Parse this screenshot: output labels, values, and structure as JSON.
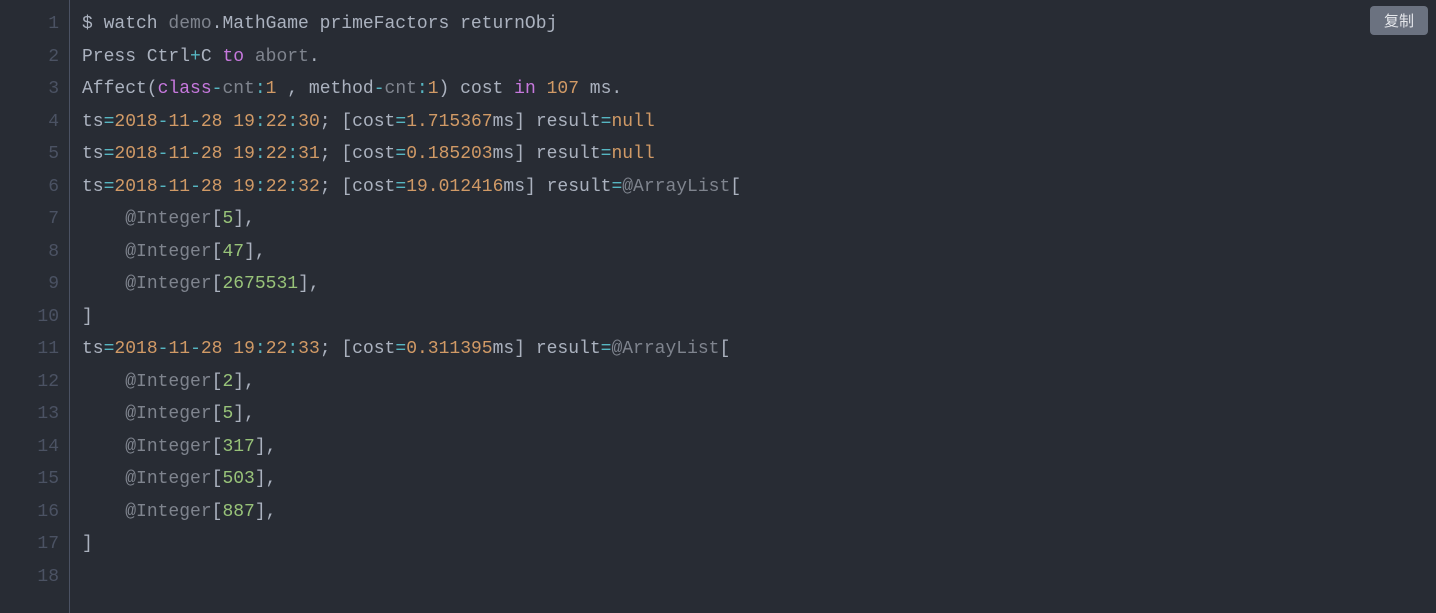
{
  "copy_button_label": "复制",
  "line_count": 18,
  "lines": {
    "1": [
      {
        "t": "$ watch ",
        "c": "tok-default"
      },
      {
        "t": "demo",
        "c": "tok-gray"
      },
      {
        "t": ".MathGame primeFactors returnObj",
        "c": "tok-default"
      }
    ],
    "2": [
      {
        "t": "Press Ctrl",
        "c": "tok-default"
      },
      {
        "t": "+",
        "c": "tok-teal"
      },
      {
        "t": "C ",
        "c": "tok-default"
      },
      {
        "t": "to",
        "c": "tok-purple"
      },
      {
        "t": " ",
        "c": "tok-default"
      },
      {
        "t": "abort",
        "c": "tok-gray"
      },
      {
        "t": ".",
        "c": "tok-default"
      }
    ],
    "3": [
      {
        "t": "Affect(",
        "c": "tok-default"
      },
      {
        "t": "class",
        "c": "tok-purple"
      },
      {
        "t": "-",
        "c": "tok-teal"
      },
      {
        "t": "cnt",
        "c": "tok-gray"
      },
      {
        "t": ":",
        "c": "tok-teal"
      },
      {
        "t": "1",
        "c": "tok-orange"
      },
      {
        "t": " , method",
        "c": "tok-default"
      },
      {
        "t": "-",
        "c": "tok-teal"
      },
      {
        "t": "cnt",
        "c": "tok-gray"
      },
      {
        "t": ":",
        "c": "tok-teal"
      },
      {
        "t": "1",
        "c": "tok-orange"
      },
      {
        "t": ") cost ",
        "c": "tok-default"
      },
      {
        "t": "in",
        "c": "tok-purple"
      },
      {
        "t": " ",
        "c": "tok-default"
      },
      {
        "t": "107",
        "c": "tok-orange"
      },
      {
        "t": " ms.",
        "c": "tok-default"
      }
    ],
    "4": [
      {
        "t": "ts",
        "c": "tok-default"
      },
      {
        "t": "=",
        "c": "tok-teal"
      },
      {
        "t": "2018",
        "c": "tok-orange"
      },
      {
        "t": "-",
        "c": "tok-teal"
      },
      {
        "t": "11",
        "c": "tok-orange"
      },
      {
        "t": "-",
        "c": "tok-teal"
      },
      {
        "t": "28",
        "c": "tok-orange"
      },
      {
        "t": " ",
        "c": "tok-default"
      },
      {
        "t": "19",
        "c": "tok-orange"
      },
      {
        "t": ":",
        "c": "tok-teal"
      },
      {
        "t": "22",
        "c": "tok-orange"
      },
      {
        "t": ":",
        "c": "tok-teal"
      },
      {
        "t": "30",
        "c": "tok-orange"
      },
      {
        "t": "; [cost",
        "c": "tok-default"
      },
      {
        "t": "=",
        "c": "tok-teal"
      },
      {
        "t": "1.715367",
        "c": "tok-orange"
      },
      {
        "t": "ms] result",
        "c": "tok-default"
      },
      {
        "t": "=",
        "c": "tok-teal"
      },
      {
        "t": "null",
        "c": "tok-orange"
      }
    ],
    "5": [
      {
        "t": "ts",
        "c": "tok-default"
      },
      {
        "t": "=",
        "c": "tok-teal"
      },
      {
        "t": "2018",
        "c": "tok-orange"
      },
      {
        "t": "-",
        "c": "tok-teal"
      },
      {
        "t": "11",
        "c": "tok-orange"
      },
      {
        "t": "-",
        "c": "tok-teal"
      },
      {
        "t": "28",
        "c": "tok-orange"
      },
      {
        "t": " ",
        "c": "tok-default"
      },
      {
        "t": "19",
        "c": "tok-orange"
      },
      {
        "t": ":",
        "c": "tok-teal"
      },
      {
        "t": "22",
        "c": "tok-orange"
      },
      {
        "t": ":",
        "c": "tok-teal"
      },
      {
        "t": "31",
        "c": "tok-orange"
      },
      {
        "t": "; [cost",
        "c": "tok-default"
      },
      {
        "t": "=",
        "c": "tok-teal"
      },
      {
        "t": "0.185203",
        "c": "tok-orange"
      },
      {
        "t": "ms] result",
        "c": "tok-default"
      },
      {
        "t": "=",
        "c": "tok-teal"
      },
      {
        "t": "null",
        "c": "tok-orange"
      }
    ],
    "6": [
      {
        "t": "ts",
        "c": "tok-default"
      },
      {
        "t": "=",
        "c": "tok-teal"
      },
      {
        "t": "2018",
        "c": "tok-orange"
      },
      {
        "t": "-",
        "c": "tok-teal"
      },
      {
        "t": "11",
        "c": "tok-orange"
      },
      {
        "t": "-",
        "c": "tok-teal"
      },
      {
        "t": "28",
        "c": "tok-orange"
      },
      {
        "t": " ",
        "c": "tok-default"
      },
      {
        "t": "19",
        "c": "tok-orange"
      },
      {
        "t": ":",
        "c": "tok-teal"
      },
      {
        "t": "22",
        "c": "tok-orange"
      },
      {
        "t": ":",
        "c": "tok-teal"
      },
      {
        "t": "32",
        "c": "tok-orange"
      },
      {
        "t": "; [cost",
        "c": "tok-default"
      },
      {
        "t": "=",
        "c": "tok-teal"
      },
      {
        "t": "19.012416",
        "c": "tok-orange"
      },
      {
        "t": "ms] result",
        "c": "tok-default"
      },
      {
        "t": "=",
        "c": "tok-teal"
      },
      {
        "t": "@ArrayList",
        "c": "tok-gray"
      },
      {
        "t": "[",
        "c": "tok-default"
      }
    ],
    "7": [
      {
        "t": "    ",
        "c": "tok-default"
      },
      {
        "t": "@Integer",
        "c": "tok-gray"
      },
      {
        "t": "[",
        "c": "tok-default"
      },
      {
        "t": "5",
        "c": "tok-green"
      },
      {
        "t": "],",
        "c": "tok-default"
      }
    ],
    "8": [
      {
        "t": "    ",
        "c": "tok-default"
      },
      {
        "t": "@Integer",
        "c": "tok-gray"
      },
      {
        "t": "[",
        "c": "tok-default"
      },
      {
        "t": "47",
        "c": "tok-green"
      },
      {
        "t": "],",
        "c": "tok-default"
      }
    ],
    "9": [
      {
        "t": "    ",
        "c": "tok-default"
      },
      {
        "t": "@Integer",
        "c": "tok-gray"
      },
      {
        "t": "[",
        "c": "tok-default"
      },
      {
        "t": "2675531",
        "c": "tok-green"
      },
      {
        "t": "],",
        "c": "tok-default"
      }
    ],
    "10": [
      {
        "t": "]",
        "c": "tok-default"
      }
    ],
    "11": [
      {
        "t": "ts",
        "c": "tok-default"
      },
      {
        "t": "=",
        "c": "tok-teal"
      },
      {
        "t": "2018",
        "c": "tok-orange"
      },
      {
        "t": "-",
        "c": "tok-teal"
      },
      {
        "t": "11",
        "c": "tok-orange"
      },
      {
        "t": "-",
        "c": "tok-teal"
      },
      {
        "t": "28",
        "c": "tok-orange"
      },
      {
        "t": " ",
        "c": "tok-default"
      },
      {
        "t": "19",
        "c": "tok-orange"
      },
      {
        "t": ":",
        "c": "tok-teal"
      },
      {
        "t": "22",
        "c": "tok-orange"
      },
      {
        "t": ":",
        "c": "tok-teal"
      },
      {
        "t": "33",
        "c": "tok-orange"
      },
      {
        "t": "; [cost",
        "c": "tok-default"
      },
      {
        "t": "=",
        "c": "tok-teal"
      },
      {
        "t": "0.311395",
        "c": "tok-orange"
      },
      {
        "t": "ms] result",
        "c": "tok-default"
      },
      {
        "t": "=",
        "c": "tok-teal"
      },
      {
        "t": "@ArrayList",
        "c": "tok-gray"
      },
      {
        "t": "[",
        "c": "tok-default"
      }
    ],
    "12": [
      {
        "t": "    ",
        "c": "tok-default"
      },
      {
        "t": "@Integer",
        "c": "tok-gray"
      },
      {
        "t": "[",
        "c": "tok-default"
      },
      {
        "t": "2",
        "c": "tok-green"
      },
      {
        "t": "],",
        "c": "tok-default"
      }
    ],
    "13": [
      {
        "t": "    ",
        "c": "tok-default"
      },
      {
        "t": "@Integer",
        "c": "tok-gray"
      },
      {
        "t": "[",
        "c": "tok-default"
      },
      {
        "t": "5",
        "c": "tok-green"
      },
      {
        "t": "],",
        "c": "tok-default"
      }
    ],
    "14": [
      {
        "t": "    ",
        "c": "tok-default"
      },
      {
        "t": "@Integer",
        "c": "tok-gray"
      },
      {
        "t": "[",
        "c": "tok-default"
      },
      {
        "t": "317",
        "c": "tok-green"
      },
      {
        "t": "],",
        "c": "tok-default"
      }
    ],
    "15": [
      {
        "t": "    ",
        "c": "tok-default"
      },
      {
        "t": "@Integer",
        "c": "tok-gray"
      },
      {
        "t": "[",
        "c": "tok-default"
      },
      {
        "t": "503",
        "c": "tok-green"
      },
      {
        "t": "],",
        "c": "tok-default"
      }
    ],
    "16": [
      {
        "t": "    ",
        "c": "tok-default"
      },
      {
        "t": "@Integer",
        "c": "tok-gray"
      },
      {
        "t": "[",
        "c": "tok-default"
      },
      {
        "t": "887",
        "c": "tok-green"
      },
      {
        "t": "],",
        "c": "tok-default"
      }
    ],
    "17": [
      {
        "t": "]",
        "c": "tok-default"
      }
    ],
    "18": []
  }
}
